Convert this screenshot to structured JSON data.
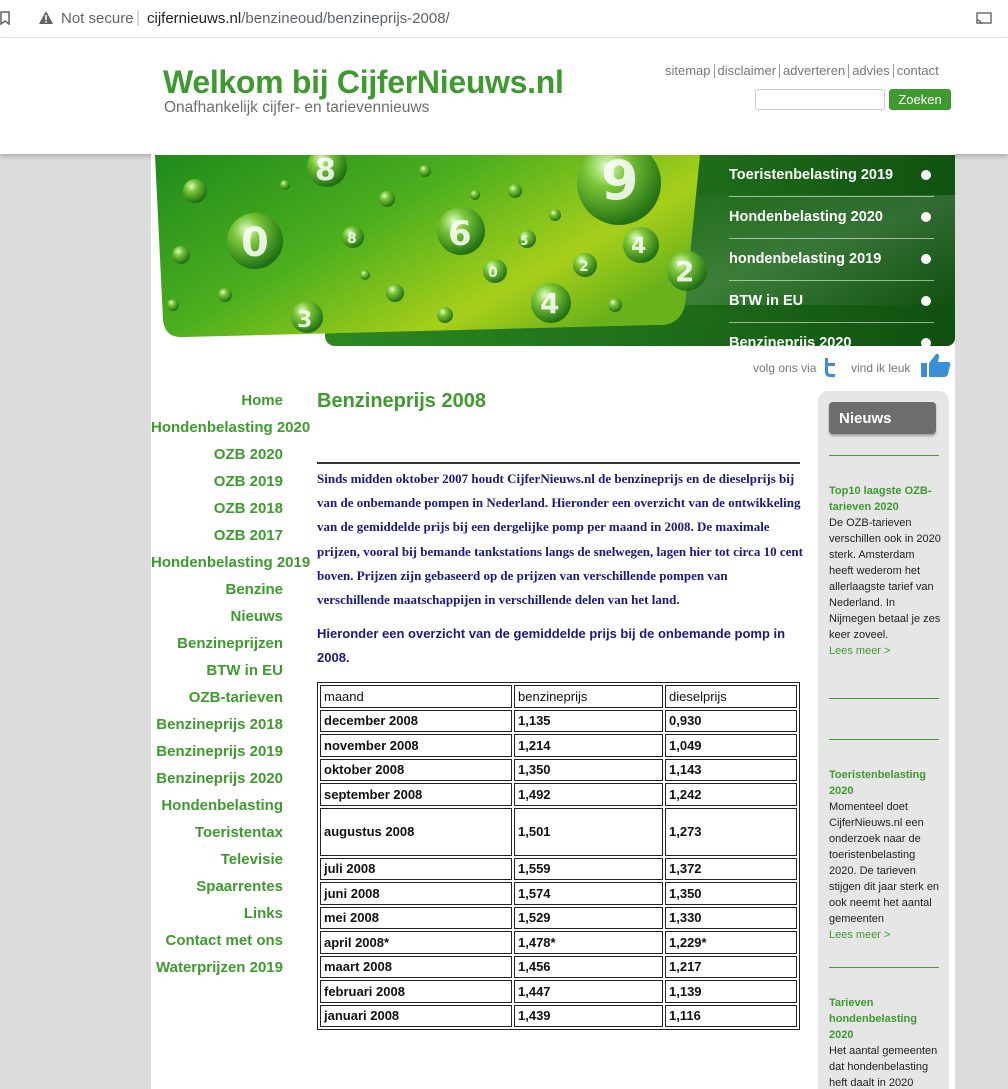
{
  "browser": {
    "security": "Not secure",
    "url_domain": "cijfernieuws.nl",
    "url_path": "/benzineoud/benzineprijs-2008/"
  },
  "header": {
    "title": "Welkom bij CijferNieuws.nl",
    "subtitle": "Onafhankelijk cijfer- en tarievennieuws",
    "links": [
      "sitemap",
      "disclaimer",
      "adverteren",
      "advies",
      "contact"
    ],
    "search_button": "Zoeken"
  },
  "banner": {
    "items": [
      "Toeristenbelasting 2019",
      "Hondenbelasting 2020",
      "hondenbelasting 2019",
      "BTW in EU",
      "Benzineprijs 2020"
    ]
  },
  "social": {
    "follow": "volg ons via",
    "like": "vind ik leuk"
  },
  "nav": {
    "items": [
      "Home",
      "Hondenbelasting 2020",
      "OZB 2020",
      "OZB 2019",
      "OZB 2018",
      "OZB 2017",
      "Hondenbelasting 2019",
      "Benzine",
      "Nieuws",
      "Benzineprijzen",
      "BTW in EU",
      "OZB-tarieven",
      "Benzineprijs 2018",
      "Benzineprijs 2019",
      "Benzineprijs 2020",
      "Hondenbelasting",
      "Toeristentax",
      "Televisie",
      "Spaarrentes",
      "Links",
      "Contact met ons",
      "Waterprijzen 2019"
    ]
  },
  "main": {
    "title": "Benzineprijs 2008",
    "intro": "Sinds midden oktober 2007 houdt CijferNieuws.nl de benzineprijs en de dieselprijs bij van de onbemande pompen in Nederland. Hieronder een overzicht van de ontwikkeling van de gemiddelde prijs bij een dergelijke pomp per maand in 2008. De maximale prijzen, vooral bij bemande tankstations langs de snelwegen, lagen hier tot circa 10 cent boven. Prijzen zijn gebaseerd op de prijzen van verschillende pompen van verschillende maatschappijen in verschillende delen van het land.",
    "intro2": "Hieronder een overzicht van de gemiddelde prijs bij de onbemande pomp in 2008.",
    "table": {
      "headers": [
        "maand",
        "benzineprijs",
        "dieselprijs"
      ],
      "rows": [
        [
          "december 2008",
          "1,135",
          "0,930"
        ],
        [
          "november 2008",
          "1,214",
          "1,049"
        ],
        [
          "oktober 2008",
          "1,350",
          "1,143"
        ],
        [
          "september 2008",
          "1,492",
          "1,242"
        ],
        [
          "augustus 2008",
          "1,501",
          "1,273"
        ],
        [
          "juli 2008",
          "1,559",
          "1,372"
        ],
        [
          "juni 2008",
          "1,574",
          "1,350"
        ],
        [
          "mei 2008",
          "1,529",
          "1,330"
        ],
        [
          "april 2008*",
          "1,478*",
          "1,229*"
        ],
        [
          "maart 2008",
          "1,456",
          "1,217"
        ],
        [
          "februari 2008",
          "1,447",
          "1,139"
        ],
        [
          "januari 2008",
          "1,439",
          "1,116"
        ]
      ]
    }
  },
  "sidebar": {
    "heading": "Nieuws",
    "more_label": "Lees meer >",
    "news": [
      {
        "title": "Top10 laagste OZB-tarieven 2020",
        "body": "De OZB-tarieven verschillen ook in 2020 sterk. Amsterdam heeft wederom het allerlaagste tarief van Nederland. In Nijmegen betaal je zes keer zoveel."
      },
      {
        "title": "Toeristenbelasting 2020",
        "body": "Momenteel doet CijferNieuws.nl een onderzoek naar de toeristenbelasting 2020. De tarieven stijgen dit jaar sterk en ook neemt het aantal gemeenten"
      },
      {
        "title": "Tarieven hondenbelasting 2020",
        "body": "Het aantal gemeenten dat hondenbelasting heft daalt in 2020"
      }
    ]
  }
}
